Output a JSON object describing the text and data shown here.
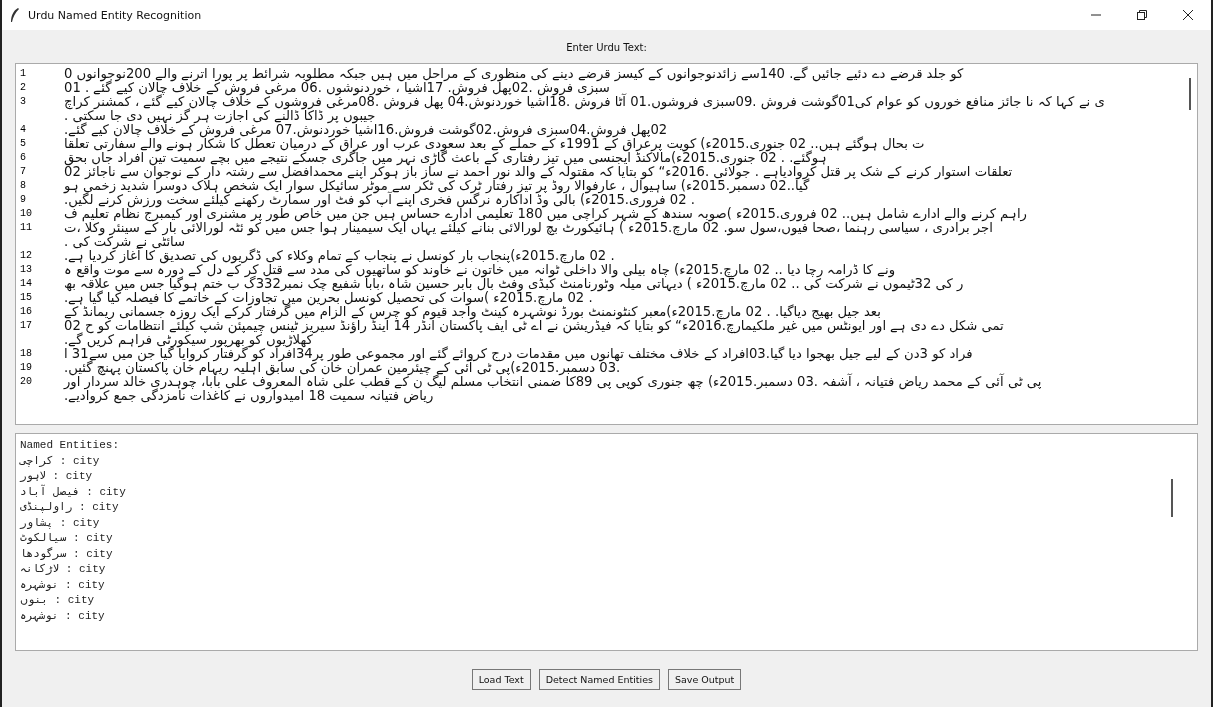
{
  "window": {
    "title": "Urdu Named Entity Recognition"
  },
  "input_label": "Enter Urdu Text:",
  "input_text": [
    {
      "number": "1",
      "segments": [
        "کو جلد قرضے دے دئیے جائیں گے. 140سے زائدنوجوانوں کے کیسز قرضے دینے کی منظوری کے مراحل میں ہیں جبکہ مطلوبہ شرائط پر پورا اترنے والے 200نوجوانوں 0"
      ]
    },
    {
      "number": "2",
      "segments": [
        "سبزی فروش .02پھل فروش. 17اشیا ، خوردنوشوں .06 مرغی فروش کے خلاف چالان کیے گئے . 01"
      ]
    },
    {
      "number": "3",
      "segments": [
        "ی نے کہا کہ نا جائز منافع خوروں کو عوام کی01گوشت فروش .09سبزی فروشوں.01 آٹا فروش .18اشیا خوردنوش.04 پھل فروش .08مرغی فروشوں کے خلاف چالان کیے گئے ، کمشنر کراچ",
        "جیبوں پر ڈاکا ڈالنے کی اجازت ہر گز نہیں دی جا سکتی ."
      ]
    },
    {
      "number": "4",
      "segments": [
        "02پھل فروش.04سبزی فروش.02گوشت فروش.16اشیا خوردنوش.07 مرغی فروش کے خلاف چالان کیے گئے."
      ]
    },
    {
      "number": "5",
      "segments": [
        "ت بحال ہوگئے ہیں.. 02 جنوری.2015ء) کویت پرعراق کے 1991ء کے حملے کے بعد سعودی عرب اور عراق کے درمیان تعطل کا شکار ہونے والے سفارتی تعلقا"
      ]
    },
    {
      "number": "6",
      "segments": [
        "ہوگئے. . 02 جنوری.2015ء)مالاکنڈ ایجنسی میں تیز رفتاری کے باعث گاڑی نہر میں جاگری جسکے نتیجے میں بچے سمیت تین افراد جاں بحق"
      ]
    },
    {
      "number": "7",
      "segments": [
        "تعلقات استوار کرنے کے شک پر قتل کروادیاہے . جولائی .2016ء“ کو بتایا کہ مقتولہ کے والد نور احمد نے ساز باز ہوکر اپنے محمدافضل سے رشتہ دار کے نوجوان سے ناجائز 02"
      ]
    },
    {
      "number": "8",
      "segments": [
        "گیا..02 دسمبر.2015ء) ساہیوال ، عارفوالا روڈ پر تیز رفتار ٹرک کی ٹکر سے موٹر سائیکل سوار ایک شخص ہلاک دوسرا شدید زخمی ہو"
      ]
    },
    {
      "number": "9",
      "segments": [
        ". 02 فروری.2015ء) بالی وڈ اداکارہ نرگس فخری اپنے آپ کو فٹ اور سمارٹ رکھنے کیلئے سخت ورزش کرنے لگیں."
      ]
    },
    {
      "number": "10",
      "segments": [
        "راہم کرنے والے ادارے شامل ہیں.. 02 فروری.2015ء )صوبہ سندھ کے شہر کراچی میں 180 تعلیمی ادارے حساس ہیں جن میں خاص طور پر مشنری اور کیمبرج نظام تعلیم ف"
      ]
    },
    {
      "number": "11",
      "segments": [
        "اجر برادری ، سیاسی رہنما ،صحا فیوں،سول سو. 02 مارچ.2015ء ) ہائیکورٹ بچ لورالائی بنانے کیلئے یہاں ایک سیمینار ہوا جس میں کو ئٹہ لورالائی بار کے سینئر وکلا ،ت",
        "سائٹی نے شرکت کی ."
      ]
    },
    {
      "number": "12",
      "segments": [
        ". 02 مارچ.2015ء)پنجاب بار کونسل نے پنجاب کے تمام وکلاء کی ڈگریوں کی تصدیق کا آغاز کردیا ہے."
      ]
    },
    {
      "number": "13",
      "segments": [
        "ونے کا ڈرامہ رچا دیا .. 02 مارچ.2015ء) چاہ بیلی والا داخلی ٹوانہ میں خاتون نے خاوند کو ساتھیوں کی مدد سے قتل کر کے دل کے دورہ سے موت واقع ہ"
      ]
    },
    {
      "number": "14",
      "segments": [
        "ر کی 32ٹیموں نے شرکت کی .. 02 مارچ.2015ء ) دیہاتی میلہ وٹورنامنٹ کبڈی وفٹ بال بابر حسین شاہ ،بابا شفیع چک نمبر332گ ب ختم ہوگیا جس میں علاقہ بھ"
      ]
    },
    {
      "number": "15",
      "segments": [
        ". 02 مارچ.2015ء )سوات کی تحصیل کونسل بحرین میں تجاوزات کے خاتمے کا فیصلہ کیا گیا ہے."
      ]
    },
    {
      "number": "16",
      "segments": [
        "بعد جیل بھیج دیاگیا. . 02 مارچ.2015ء)معبر کنٹونمنٹ بورڈ نوشہرہ کینٹ واجد قیوم کو چرس کے الزام میں گرفتار کرکے ایک روزہ جسمانی ریمانڈ کے"
      ]
    },
    {
      "number": "17",
      "segments": [
        "تمی شکل دے دی ہے اور ایونٹس میں غیر ملکیمارچ.2016ء“ کو بتایا کہ فیڈریشن نے اے ٹی ایف پاکستان انڈر 14 اینڈ راؤنڈ سیریز ٹینس چیمپئن شپ کیلئے انتظامات کو ح 02",
        "کھلاڑیوں کو بھرپور سیکورٹی فراہم کریں گے."
      ]
    },
    {
      "number": "18",
      "segments": [
        "فراد کو 3دن کے لیے جیل بھجوا دیا گیا.03افراد کے خلاف مختلف تھانوں میں مقدمات درج کروائے گئے اور مجموعی طور پر34افراد کو گرفتار کروایا گیا جن میں سے31 ا"
      ]
    },
    {
      "number": "19",
      "segments": [
        ".03 دسمبر.2015ء)پی ٹی آئی کے چیئرمین عمران خان کی سابق اہلیہ ریہام خان پاکستان پہنچ گئیں."
      ]
    },
    {
      "number": "20",
      "segments": [
        "پی ٹی آئی کے محمد ریاض فتیانہ ، آشفہ .03 دسمبر.2015ء) چھ جنوری کوپی پی 89کا ضمنی انتخاب مسلم لیگ ن کے قطب علی شاہ المعروف علی بابا، چوہدری خالد سردار اور",
        "ریاض فتیانہ سمیت 18 امیدواروں نے کاغذات نامزدگی جمع کروادیے."
      ]
    }
  ],
  "output": {
    "heading": "Named Entities:",
    "lines": [
      "کراچی : city",
      "لاہور : city",
      "فیصل آباد : city",
      "راولپنڈی : city",
      "پشاور : city",
      "سیالکوٹ : city",
      "سرگودھا : city",
      "لاڑکانہ : city",
      "نوشہرہ : city",
      "بنوں : city",
      "نوشہرہ : city"
    ]
  },
  "load_button": "Load Text",
  "detect_button": "Detect Named Entities",
  "save_button": "Save Output"
}
